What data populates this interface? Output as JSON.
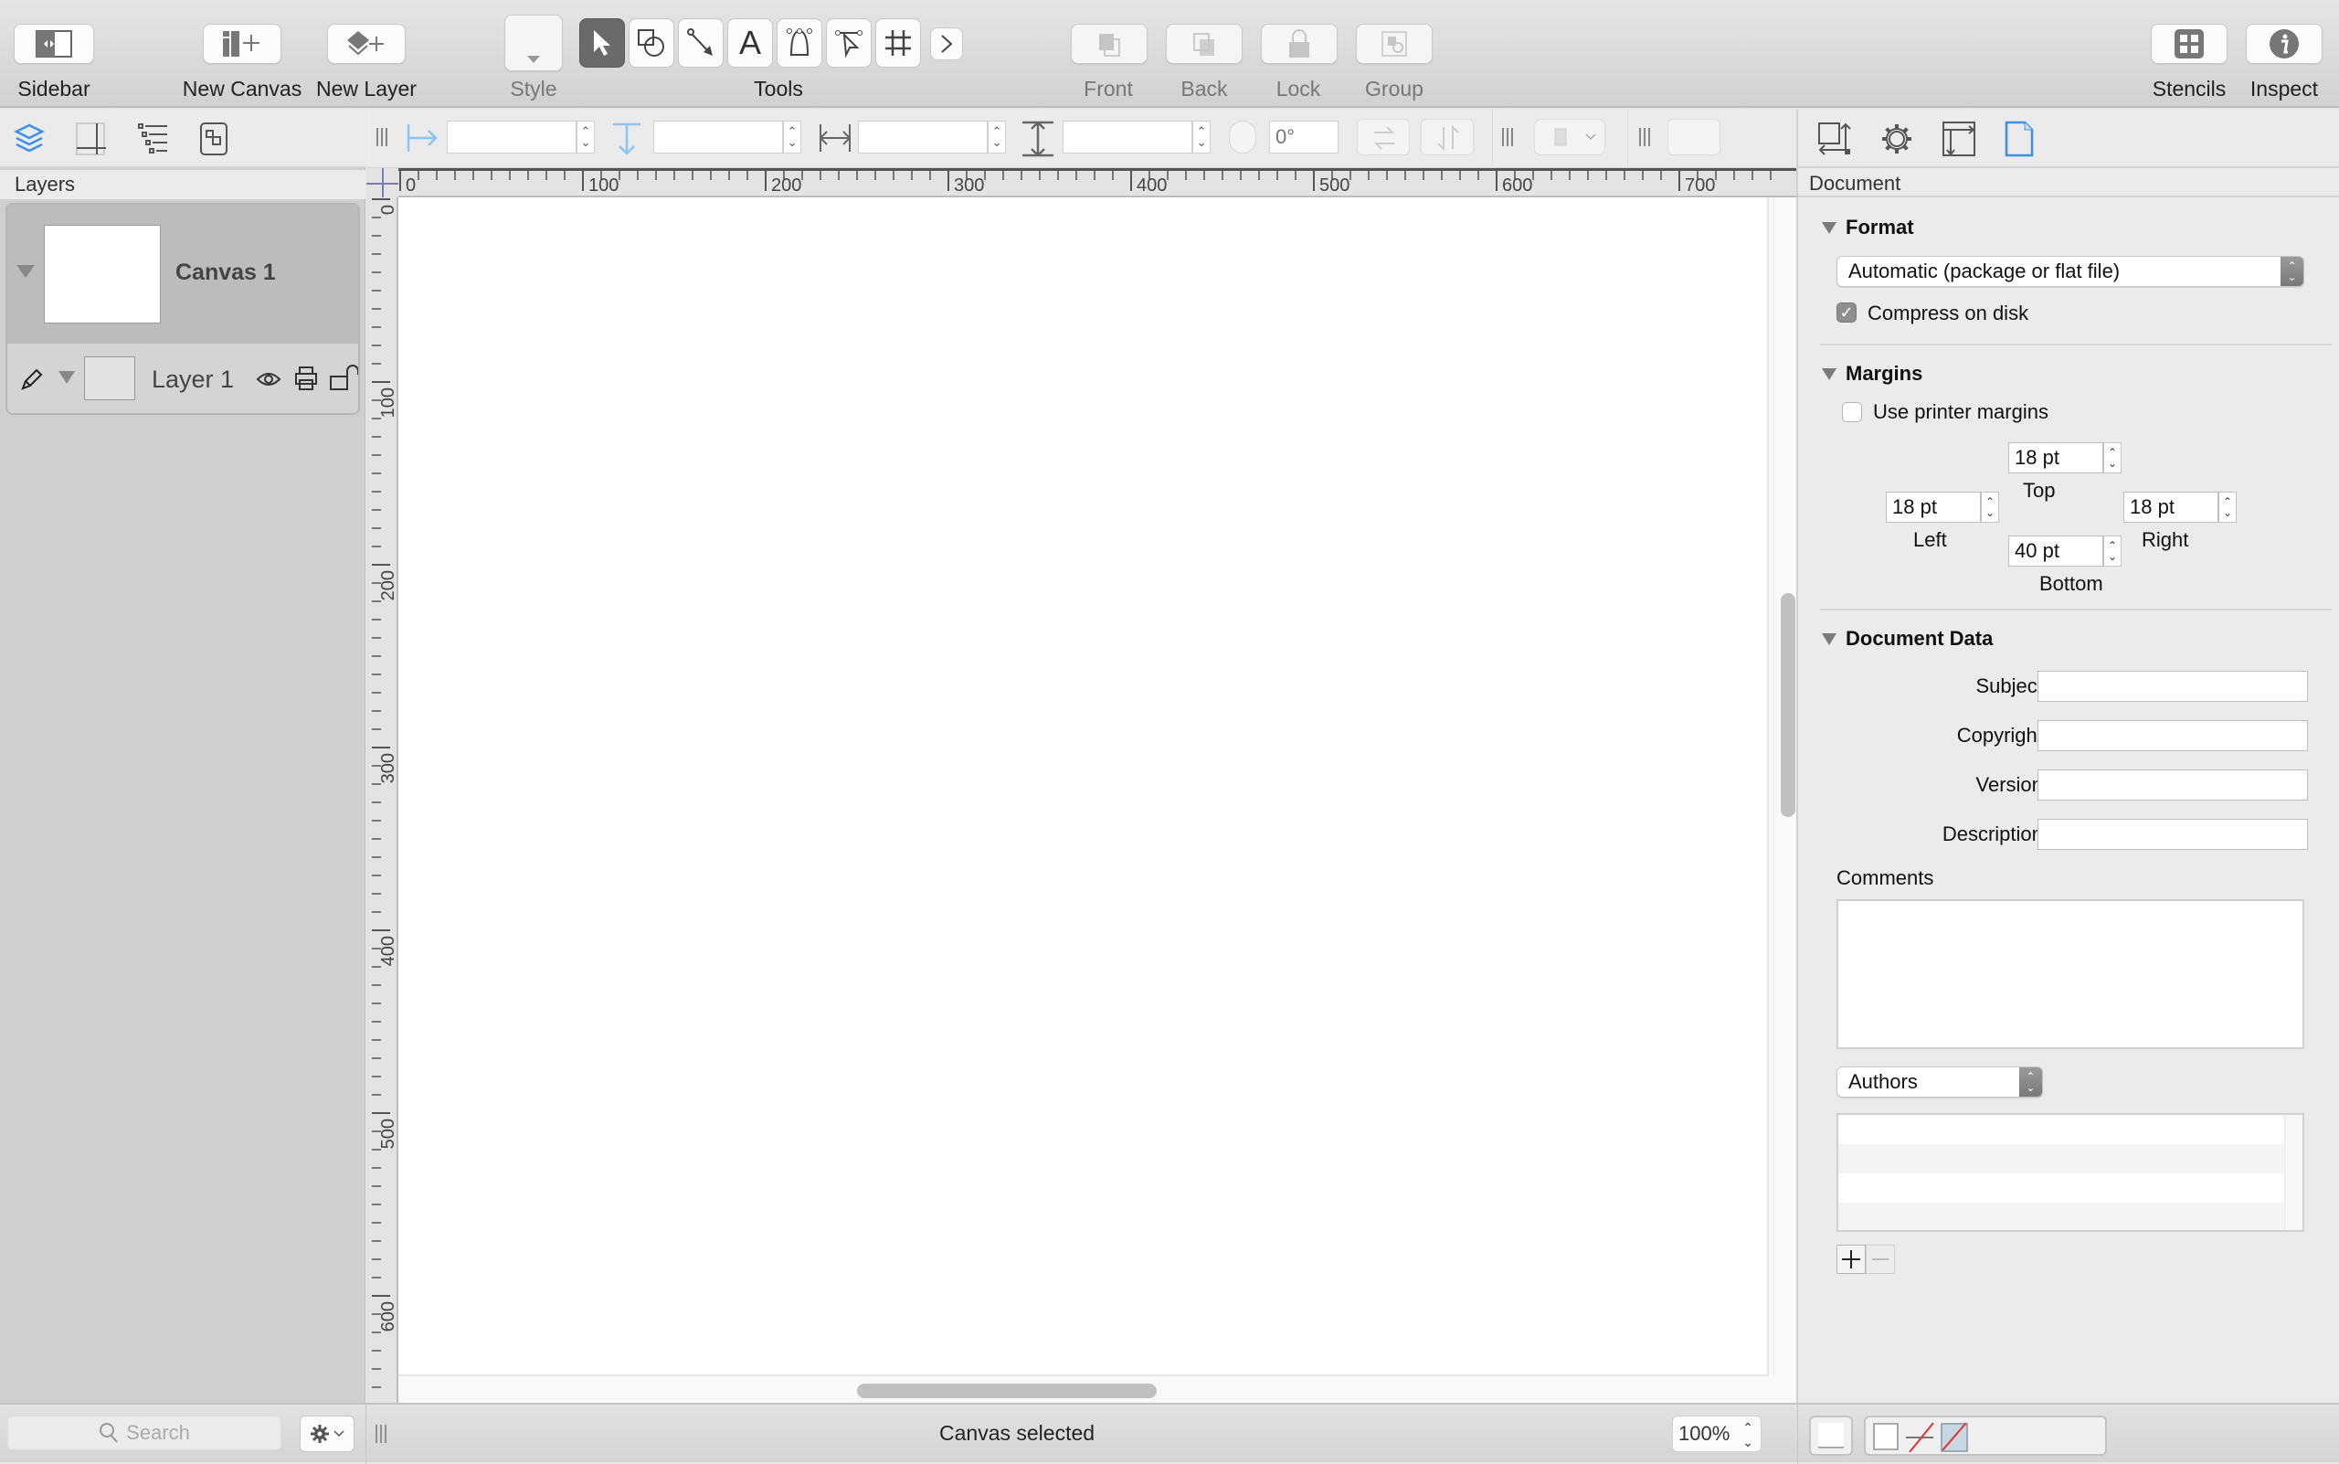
{
  "toolbar": {
    "sidebar_label": "Sidebar",
    "new_canvas_label": "New Canvas",
    "new_layer_label": "New Layer",
    "style_label": "Style",
    "tools_label": "Tools",
    "front_label": "Front",
    "back_label": "Back",
    "lock_label": "Lock",
    "group_label": "Group",
    "stencils_label": "Stencils",
    "inspect_label": "Inspect",
    "tools": [
      {
        "icon": "selection-arrow-icon",
        "active": true
      },
      {
        "icon": "shape-tool-icon",
        "active": false
      },
      {
        "icon": "line-tool-icon",
        "active": false
      },
      {
        "icon": "text-tool-icon",
        "glyph": "A",
        "active": false
      },
      {
        "icon": "pen-tool-icon",
        "active": false
      },
      {
        "icon": "point-editor-icon",
        "active": false
      },
      {
        "icon": "table-tool-icon",
        "glyph": "#",
        "active": false
      },
      {
        "icon": "more-tools-chevron-icon",
        "glyph": "›",
        "active": false
      }
    ]
  },
  "sidebar": {
    "layers_header": "Layers",
    "canvas": {
      "name": "Canvas 1"
    },
    "layers": [
      {
        "name": "Layer 1"
      }
    ],
    "search_placeholder": "Search"
  },
  "geometry_bar": {
    "x_value": "",
    "y_value": "",
    "width_value": "",
    "height_value": "",
    "rotation_placeholder": "0°"
  },
  "rulers": {
    "horizontal_labels": [
      "0",
      "100",
      "200",
      "300",
      "400",
      "500",
      "600",
      "700"
    ],
    "vertical_labels": [
      "0",
      "100",
      "200",
      "300",
      "400",
      "500",
      "600"
    ]
  },
  "inspector": {
    "title": "Document",
    "format": {
      "header": "Format",
      "file_format": "Automatic (package or flat file)",
      "compress_label": "Compress on disk",
      "compress_checked": true
    },
    "margins": {
      "header": "Margins",
      "use_printer_label": "Use printer margins",
      "use_printer_checked": false,
      "top": "18 pt",
      "top_label": "Top",
      "left": "18 pt",
      "left_label": "Left",
      "right": "18 pt",
      "right_label": "Right",
      "bottom": "40 pt",
      "bottom_label": "Bottom"
    },
    "document_data": {
      "header": "Document Data",
      "subject_label": "Subject:",
      "subject": "",
      "copyright_label": "Copyright:",
      "copyright": "",
      "version_label": "Version:",
      "version": "",
      "description_label": "Description:",
      "description": "",
      "comments_label": "Comments",
      "comments": "",
      "list_selector": "Authors",
      "authors": []
    }
  },
  "status": {
    "message": "Canvas selected",
    "zoom": "100%"
  }
}
